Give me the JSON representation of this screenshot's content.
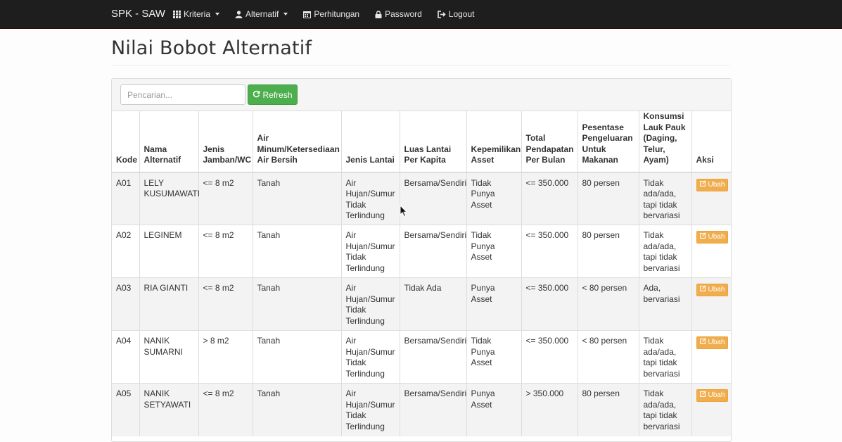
{
  "navbar": {
    "brand": "SPK - SAW",
    "items": [
      {
        "label": "Kriteria",
        "icon": "grid-icon",
        "dropdown": true
      },
      {
        "label": "Alternatif",
        "icon": "user-icon",
        "dropdown": true
      },
      {
        "label": "Perhitungan",
        "icon": "calendar-icon",
        "dropdown": false
      },
      {
        "label": "Password",
        "icon": "lock-icon",
        "dropdown": false
      },
      {
        "label": "Logout",
        "icon": "logout-icon",
        "dropdown": false
      }
    ]
  },
  "page": {
    "title": "Nilai Bobot Alternatif"
  },
  "toolbar": {
    "search_placeholder": "Pencarian...",
    "search_value": "",
    "refresh_label": "Refresh"
  },
  "table": {
    "columns": [
      "Kode",
      "Nama Alternatif",
      "Jenis Jamban/WC",
      "Air Minum/Ketersediaan Air Bersih",
      "Jenis Lantai",
      "Luas Lantai Per Kapita",
      "Kepemilikan Asset",
      "Total Pendapatan Per Bulan",
      "Pesentase Pengeluaran Untuk Makanan",
      "Konsumsi Lauk Pauk (Daging, Telur, Ayam)",
      "Aksi"
    ],
    "action_label": "Ubah",
    "rows": [
      [
        "A01",
        "LELY KUSUMAWATI",
        "<= 8 m2",
        "Tanah",
        "Air Hujan/Sumur Tidak Terlindung",
        "Bersama/Sendiri",
        "Tidak Punya Asset",
        "<= 350.000",
        "80 persen",
        "Tidak ada/ada, tapi tidak bervariasi"
      ],
      [
        "A02",
        "LEGINEM",
        "<= 8 m2",
        "Tanah",
        "Air Hujan/Sumur Tidak Terlindung",
        "Bersama/Sendiri",
        "Tidak Punya Asset",
        "<= 350.000",
        "80 persen",
        "Tidak ada/ada, tapi tidak bervariasi"
      ],
      [
        "A03",
        "RIA GIANTI",
        "<= 8 m2",
        "Tanah",
        "Air Hujan/Sumur Tidak Terlindung",
        "Tidak Ada",
        "Punya Asset",
        "<= 350.000",
        "< 80 persen",
        "Ada, bervariasi"
      ],
      [
        "A04",
        "NANIK SUMARNI",
        "> 8 m2",
        "Tanah",
        "Air Hujan/Sumur Tidak Terlindung",
        "Bersama/Sendiri",
        "Tidak Punya Asset",
        "<= 350.000",
        "< 80 persen",
        "Tidak ada/ada, tapi tidak bervariasi"
      ],
      [
        "A05",
        "NANIK SETYAWATI",
        "<= 8 m2",
        "Tanah",
        "Air Hujan/Sumur Tidak Terlindung",
        "Bersama/Sendiri",
        "Punya Asset",
        "> 350.000",
        "80 persen",
        "Tidak ada/ada, tapi tidak bervariasi"
      ]
    ]
  },
  "colors": {
    "navbar_bg": "#1e1e1e",
    "refresh_button": "#4cae4c",
    "ubah_button": "#f0ad4e",
    "row_stripe": "#f3f3f3"
  }
}
